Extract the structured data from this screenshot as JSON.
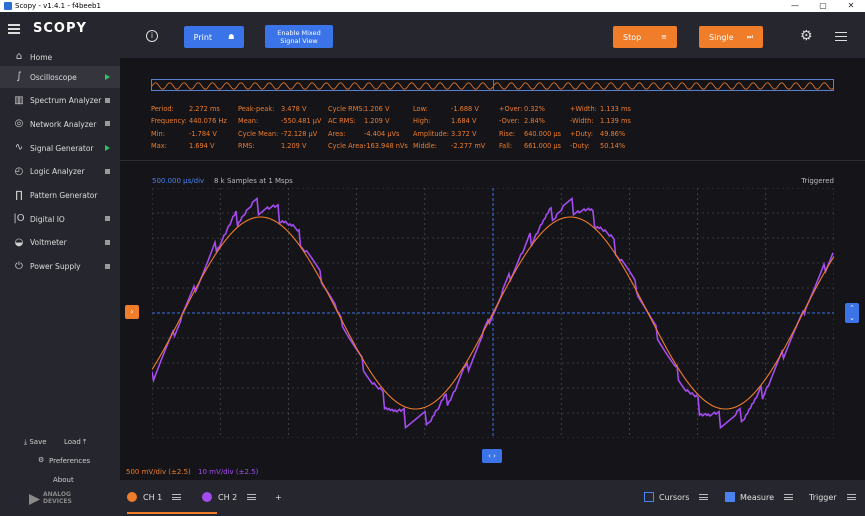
{
  "window": {
    "title": "Scopy - v1.4.1 - f4beeb1",
    "controls": [
      "—",
      "▢",
      "✕"
    ]
  },
  "sidebar": {
    "brand": "SCOPY",
    "home": "Home",
    "items": [
      {
        "label": "Oscilloscope",
        "icon": "oscilloscope-icon",
        "indicator": "running"
      },
      {
        "label": "Spectrum Analyzer",
        "icon": "spectrum-icon",
        "indicator": "stopped"
      },
      {
        "label": "Network Analyzer",
        "icon": "network-icon",
        "indicator": "stopped"
      },
      {
        "label": "Signal Generator",
        "icon": "signal-icon",
        "indicator": "running"
      },
      {
        "label": "Logic Analyzer",
        "icon": "logic-icon",
        "indicator": "stopped"
      },
      {
        "label": "Pattern Generator",
        "icon": "pattern-icon",
        "indicator": "none"
      },
      {
        "label": "Digital IO",
        "icon": "digital-io-icon",
        "indicator": "stopped"
      },
      {
        "label": "Voltmeter",
        "icon": "voltmeter-icon",
        "indicator": "stopped"
      },
      {
        "label": "Power Supply",
        "icon": "power-icon",
        "indicator": "stopped"
      }
    ],
    "save": "Save",
    "load": "Load",
    "preferences": "Preferences",
    "about": "About",
    "vendor_line1": "ANALOG",
    "vendor_line2": "DEVICES"
  },
  "toolbar": {
    "print": "Print",
    "mixed_line1": "Enable Mixed",
    "mixed_line2": "Signal View",
    "stop": "Stop",
    "single": "Single",
    "colors": {
      "blue": "#3b73e8",
      "orange": "#f07d2a"
    }
  },
  "measurements": [
    [
      [
        "Period:",
        "2.272 ms"
      ],
      [
        "Peak-peak:",
        "3.478 V"
      ],
      [
        "Cycle RMS:",
        "1.206 V"
      ],
      [
        "Low:",
        "-1.688 V"
      ],
      [
        "+Over:",
        "0.32%"
      ],
      [
        "+Width:",
        "1.133 ms"
      ]
    ],
    [
      [
        "Frequency:",
        "440.076 Hz"
      ],
      [
        "Mean:",
        "-550.481 µV"
      ],
      [
        "AC RMS:",
        "1.209 V"
      ],
      [
        "High:",
        "1.684 V"
      ],
      [
        "-Over:",
        "2.84%"
      ],
      [
        "-Width:",
        "1.139 ms"
      ]
    ],
    [
      [
        "Min:",
        "-1.784 V"
      ],
      [
        "Cycle Mean:",
        "-72.128 µV"
      ],
      [
        "Area:",
        "-4.404 µVs"
      ],
      [
        "Amplitude:",
        "3.372 V"
      ],
      [
        "Rise:",
        "640.000 µs"
      ],
      [
        "+Duty:",
        "49.86%"
      ]
    ],
    [
      [
        "Max:",
        "1.694 V"
      ],
      [
        "RMS:",
        "1.209 V"
      ],
      [
        "Cycle Area:",
        "-163.948 nVs"
      ],
      [
        "Middle:",
        "-2.277 mV"
      ],
      [
        "Fall:",
        "661.000 µs"
      ],
      [
        "-Duty:",
        "50.14%"
      ]
    ]
  ],
  "plot": {
    "timebase": "500.000 µs/div",
    "samples": "8 k Samples at 1 Msps",
    "status": "Triggered",
    "ch1_scale": "500 mV/div (±2.5)",
    "ch2_scale": "10 mV/div (±2.5)",
    "ch1_color": "#f07d2a",
    "ch2_color": "#a44cf0",
    "grid_color": "#5a5a66",
    "cursor_color": "#3b73e8",
    "frequency_hz": 440.076,
    "time_span_ms": 5.0
  },
  "bottom": {
    "ch1": "CH 1",
    "ch2": "CH 2",
    "add": "+",
    "cursors": "Cursors",
    "measure": "Measure",
    "trigger": "Trigger"
  }
}
